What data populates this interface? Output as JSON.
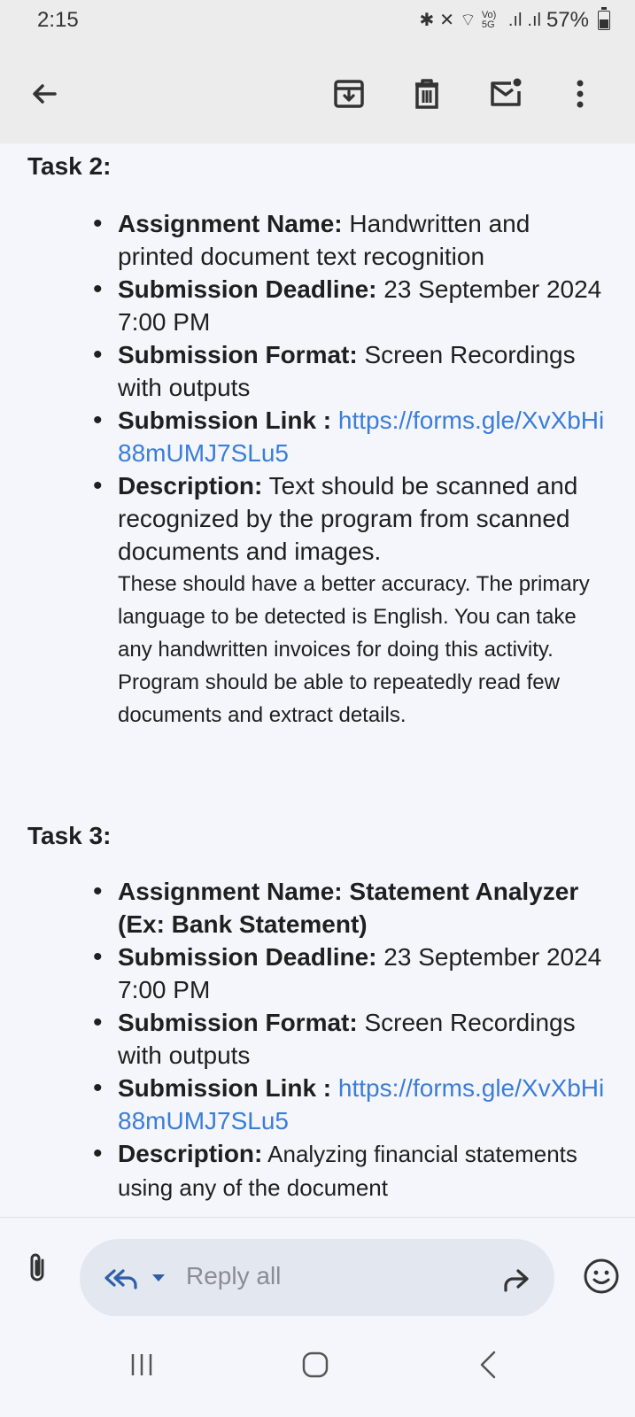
{
  "status": {
    "time": "2:15",
    "network_label": "Vo) 5G",
    "battery": "57%"
  },
  "toolbar": {
    "back": "back-arrow-icon",
    "archive": "archive-icon",
    "delete": "trash-icon",
    "mark_unread": "mark-unread-icon",
    "more": "more-vert-icon"
  },
  "tasks": [
    {
      "heading": "Task 2:",
      "items": [
        {
          "label": "Assignment Name:",
          "value": " Handwritten and printed document text recognition"
        },
        {
          "label": "Submission Deadline:",
          "value": " 23 September 2024 7:00 PM"
        },
        {
          "label": "Submission Format:",
          "value": " Screen Recordings with outputs"
        },
        {
          "label": "Submission Link :",
          "link": "https://forms.gle/XvXbHi88mUMJ7SLu5"
        },
        {
          "label": "Description:",
          "value": "  Text should be scanned and recognized by the program from scanned documents and images.",
          "small": "These should have a better accuracy. The primary language to be detected is English. You can take any handwritten invoices for doing this activity. Program should be able to repeatedly read few documents and extract details."
        }
      ]
    },
    {
      "heading": "Task 3:",
      "items": [
        {
          "label": "Assignment Name: Statement Analyzer (Ex: Bank Statement)"
        },
        {
          "label": "Submission Deadline:",
          "value": " 23 September 2024 7:00 PM"
        },
        {
          "label": "Submission Format:",
          "value": " Screen Recordings with outputs"
        },
        {
          "label": "Submission Link :",
          "link": "https://forms.gle/XvXbHi88mUMJ7SLu5"
        },
        {
          "label": "Description:",
          "value": "  Analyzing financial statements using any of the document"
        }
      ]
    }
  ],
  "reply": {
    "placeholder": "Reply all"
  },
  "colors": {
    "link": "#3b7dd8",
    "background": "#f4f6fb",
    "toolbar": "#ececec"
  }
}
